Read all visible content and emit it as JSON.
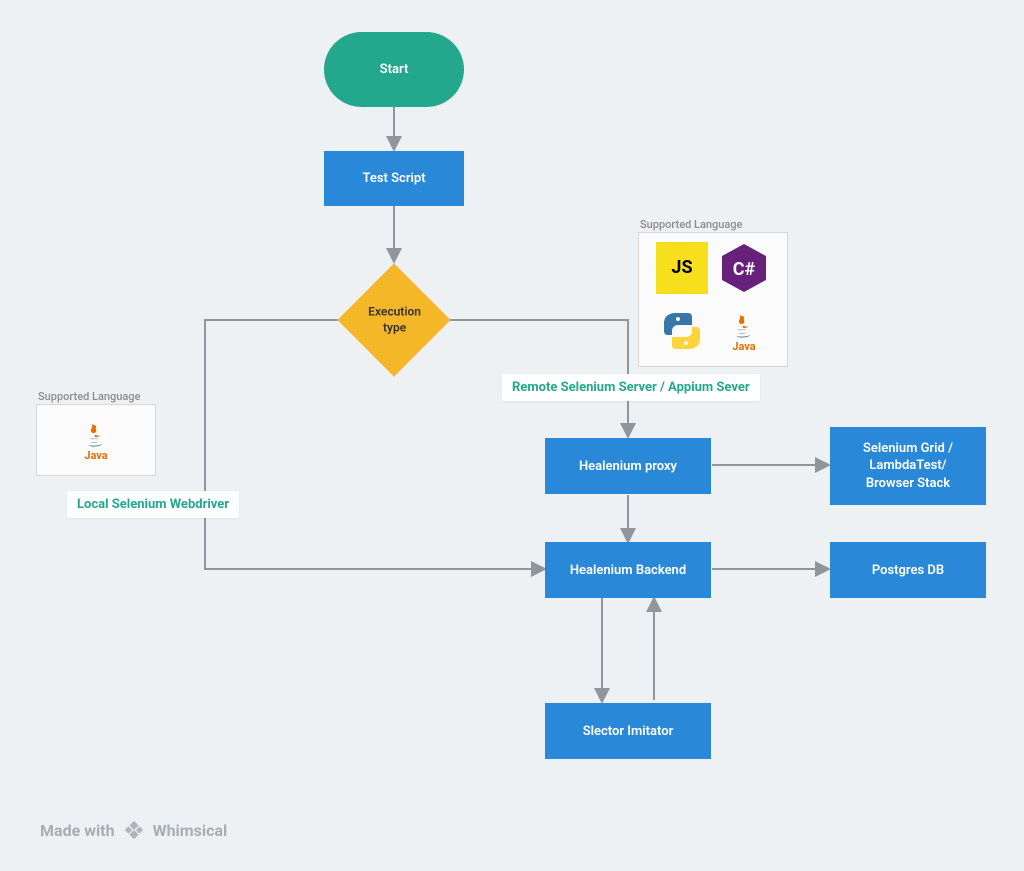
{
  "nodes": {
    "start": "Start",
    "test_script": "Test Script",
    "execution_type": "Execution\ntype",
    "healenium_proxy": "Healenium proxy",
    "selenium_grid": "Selenium Grid /\nLambdaTest/\nBrowser Stack",
    "healenium_backend": "Healenium Backend",
    "postgres_db": "Postgres DB",
    "slector_imitator": "Slector Imitator"
  },
  "labels": {
    "supported_language_left": "Supported Language",
    "supported_language_right": "Supported Language",
    "local_webdriver": "Local Selenium Webdriver",
    "remote_server": "Remote Selenium Server / Appium Sever"
  },
  "lang_icons": {
    "js": "JS",
    "csharp": "C#",
    "python": "python",
    "java": "Java"
  },
  "footer": {
    "made_with": "Made with",
    "brand": "Whimsical"
  }
}
